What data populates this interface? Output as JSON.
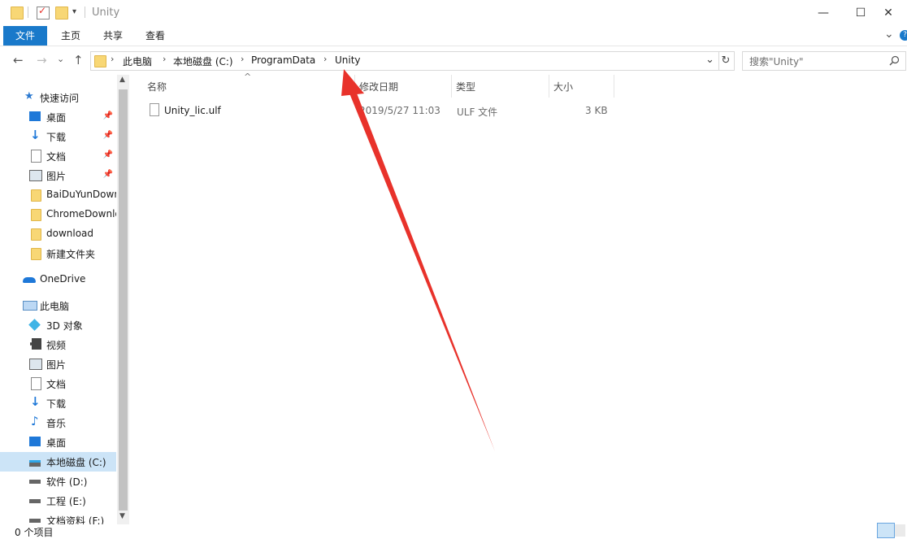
{
  "window": {
    "title": "Unity",
    "controls": {
      "minimize": "—",
      "maximize": "☐",
      "close": "✕"
    }
  },
  "ribbon": {
    "tabs": [
      "文件",
      "主页",
      "共享",
      "查看"
    ],
    "expand": "⌄",
    "help": "?"
  },
  "nav_buttons": {
    "back": "←",
    "forward": "→",
    "recent": "⌄",
    "up": "↑"
  },
  "address": {
    "breadcrumb": [
      "此电脑",
      "本地磁盘 (C:)",
      "ProgramData",
      "Unity"
    ],
    "separator": "›",
    "dropdown": "⌄",
    "refresh": "↻"
  },
  "search": {
    "placeholder": "搜索\"Unity\"",
    "icon": "search-icon"
  },
  "columns": {
    "name": "名称",
    "modified": "修改日期",
    "type": "类型",
    "size": "大小"
  },
  "sort_indicator": "^",
  "files": [
    {
      "name": "Unity_lic.ulf",
      "modified": "2019/5/27 11:03",
      "type": "ULF 文件",
      "size": "3 KB"
    }
  ],
  "nav": {
    "quick_access": "快速访问",
    "quick_items": [
      "桌面",
      "下载",
      "文档",
      "图片",
      "BaiDuYunDownload",
      "ChromeDownload",
      "download",
      "新建文件夹"
    ],
    "onedrive": "OneDrive",
    "this_pc": "此电脑",
    "pc_items": [
      "3D 对象",
      "视频",
      "图片",
      "文档",
      "下载",
      "音乐",
      "桌面",
      "本地磁盘 (C:)",
      "软件 (D:)",
      "工程 (E:)",
      "文档资料 (F:)"
    ]
  },
  "status": {
    "items": "0 个项目"
  },
  "colors": {
    "accent": "#1979ca",
    "annotation": "#e8322b",
    "selected": "#cce4f7"
  }
}
